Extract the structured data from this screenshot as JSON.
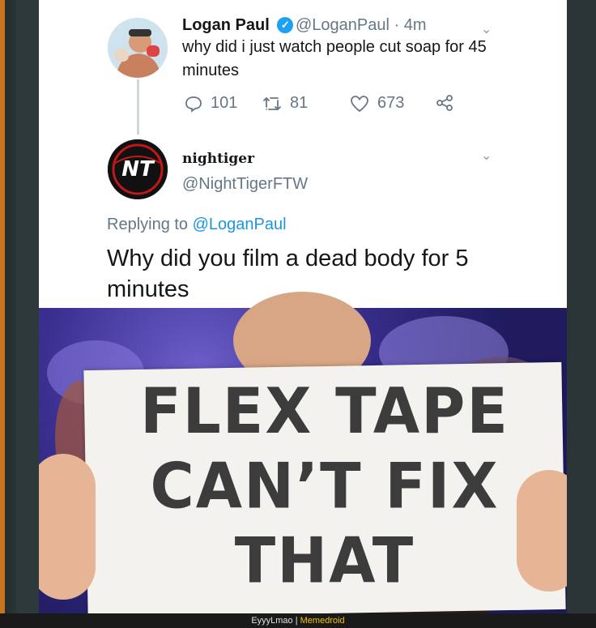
{
  "tweet1": {
    "name": "Logan Paul",
    "handle": "@LoganPaul",
    "time": "· 4m",
    "text": "why did i just watch people cut soap for 45 minutes",
    "replies": "101",
    "retweets": "81",
    "likes": "673"
  },
  "tweet2": {
    "display_name": "nightiger",
    "handle": "@NightTigerFTW",
    "avatar_text": "NT",
    "replying_prefix": "Replying to",
    "replying_handle": "@LoganPaul",
    "text": "Why did you film a dead body for 5 minutes"
  },
  "sign": {
    "line1": "FLEX TAPE",
    "line2": "CAN’T FIX",
    "line3": "THAT"
  },
  "footer": {
    "left": "EyyyLmao |",
    "brand": "Memedroid"
  },
  "colors": {
    "twitter_blue": "#1da1f2",
    "link_blue": "#1b95e0",
    "gray_text": "#657786",
    "brand_yellow": "#f5c400"
  }
}
